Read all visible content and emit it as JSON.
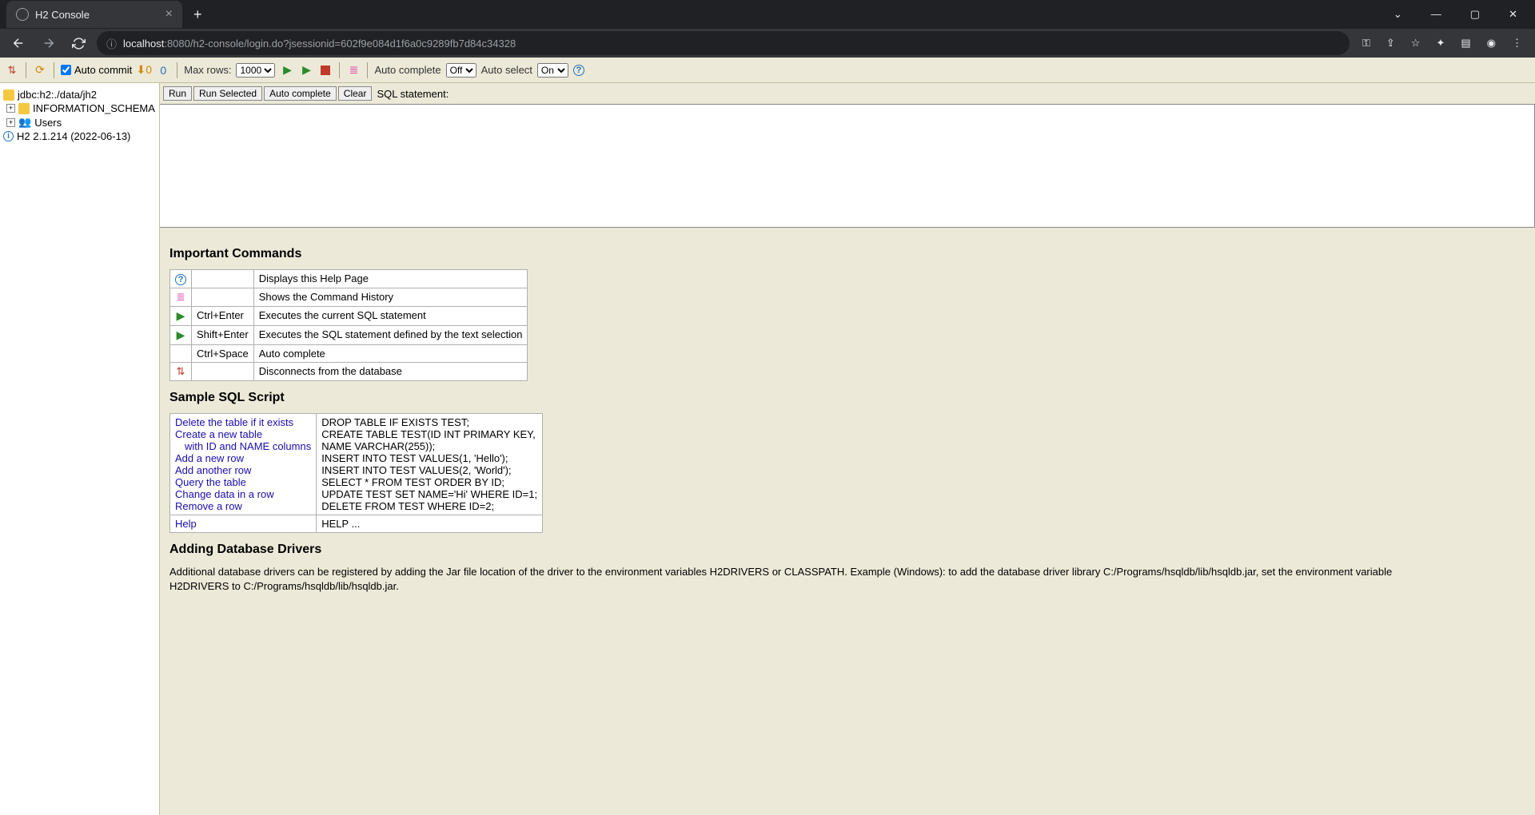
{
  "browser": {
    "tab_title": "H2 Console",
    "url_host": "localhost",
    "url_path": ":8080/h2-console/login.do?jsessionid=602f9e084d1f6a0c9289fb7d84c34328"
  },
  "toolbar": {
    "autocommit_label": "Auto commit",
    "autocommit_checked": true,
    "maxrows_label": "Max rows:",
    "maxrows_value": "1000",
    "autocomplete_label": "Auto complete",
    "autocomplete_value": "Off",
    "autoselect_label": "Auto select",
    "autoselect_value": "On"
  },
  "sidebar": {
    "db_url": "jdbc:h2:./data/jh2",
    "schema": "INFORMATION_SCHEMA",
    "users": "Users",
    "version": "H2 2.1.214 (2022-06-13)"
  },
  "sqlbar": {
    "run": "Run",
    "run_selected": "Run Selected",
    "auto_complete": "Auto complete",
    "clear": "Clear",
    "label": "SQL statement:"
  },
  "important": {
    "heading": "Important Commands",
    "rows": [
      {
        "key": "",
        "desc": "Displays this Help Page"
      },
      {
        "key": "",
        "desc": "Shows the Command History"
      },
      {
        "key": "Ctrl+Enter",
        "desc": "Executes the current SQL statement"
      },
      {
        "key": "Shift+Enter",
        "desc": "Executes the SQL statement defined by the text selection"
      },
      {
        "key": "Ctrl+Space",
        "desc": "Auto complete"
      },
      {
        "key": "",
        "desc": "Disconnects from the database"
      }
    ]
  },
  "sample": {
    "heading": "Sample SQL Script",
    "links": [
      "Delete the table if it exists",
      "Create a new table",
      "with ID and NAME columns",
      "Add a new row",
      "Add another row",
      "Query the table",
      "Change data in a row",
      "Remove a row"
    ],
    "sql": [
      "DROP TABLE IF EXISTS TEST;",
      "CREATE TABLE TEST(ID INT PRIMARY KEY,",
      "   NAME VARCHAR(255));",
      "INSERT INTO TEST VALUES(1, 'Hello');",
      "INSERT INTO TEST VALUES(2, 'World');",
      "SELECT * FROM TEST ORDER BY ID;",
      "UPDATE TEST SET NAME='Hi' WHERE ID=1;",
      "DELETE FROM TEST WHERE ID=2;"
    ],
    "help_link": "Help",
    "help_sql": "HELP ..."
  },
  "drivers": {
    "heading": "Adding Database Drivers",
    "text": "Additional database drivers can be registered by adding the Jar file location of the driver to the environment variables H2DRIVERS or CLASSPATH. Example (Windows): to add the database driver library C:/Programs/hsqldb/lib/hsqldb.jar, set the environment variable H2DRIVERS to C:/Programs/hsqldb/lib/hsqldb.jar."
  }
}
